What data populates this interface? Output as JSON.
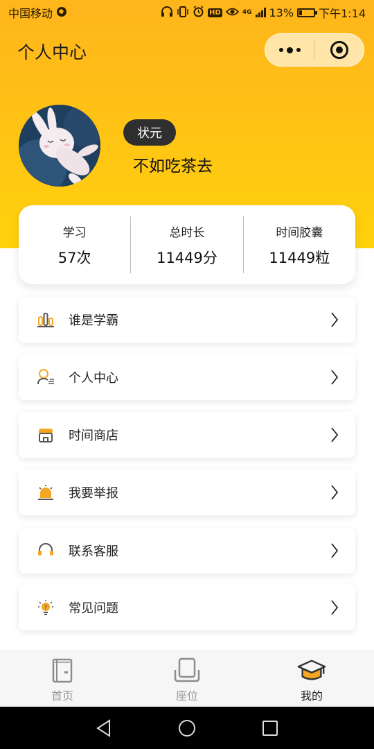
{
  "status_bar": {
    "carrier": "中国移动",
    "battery": "13%",
    "time": "下午1:14",
    "hd": "HD",
    "network": "4G",
    "icons": [
      "headphones-icon",
      "vibrate-icon",
      "alarm-icon",
      "eye-icon",
      "signal-icon",
      "battery-icon"
    ]
  },
  "header": {
    "title": "个人中心",
    "capsule": {
      "more_icon": "more-dots-icon",
      "close_icon": "target-close-icon"
    }
  },
  "profile": {
    "badge": "状元",
    "nickname": "不如吃茶去",
    "avatar_icon": "rabbit-avatar"
  },
  "stats": [
    {
      "label": "学习",
      "value": "57次"
    },
    {
      "label": "总时长",
      "value": "11449分"
    },
    {
      "label": "时间胶囊",
      "value": "11449粒"
    }
  ],
  "menu": [
    {
      "label": "谁是学霸",
      "icon": "ranking-bars-icon"
    },
    {
      "label": "个人中心",
      "icon": "user-profile-icon"
    },
    {
      "label": "时间商店",
      "icon": "store-icon"
    },
    {
      "label": "我要举报",
      "icon": "alarm-siren-icon"
    },
    {
      "label": "联系客服",
      "icon": "headset-icon"
    },
    {
      "label": "常见问题",
      "icon": "lightbulb-icon"
    }
  ],
  "tabs": [
    {
      "label": "首页",
      "icon": "book-icon",
      "active": false
    },
    {
      "label": "座位",
      "icon": "seat-icon",
      "active": false
    },
    {
      "label": "我的",
      "icon": "graduation-cap-icon",
      "active": true
    }
  ],
  "colors": {
    "accent_top": "#ffb51c",
    "accent_bottom": "#ffd20c",
    "badge_bg": "#2f2f2f",
    "active_icon": "#f5a623"
  }
}
